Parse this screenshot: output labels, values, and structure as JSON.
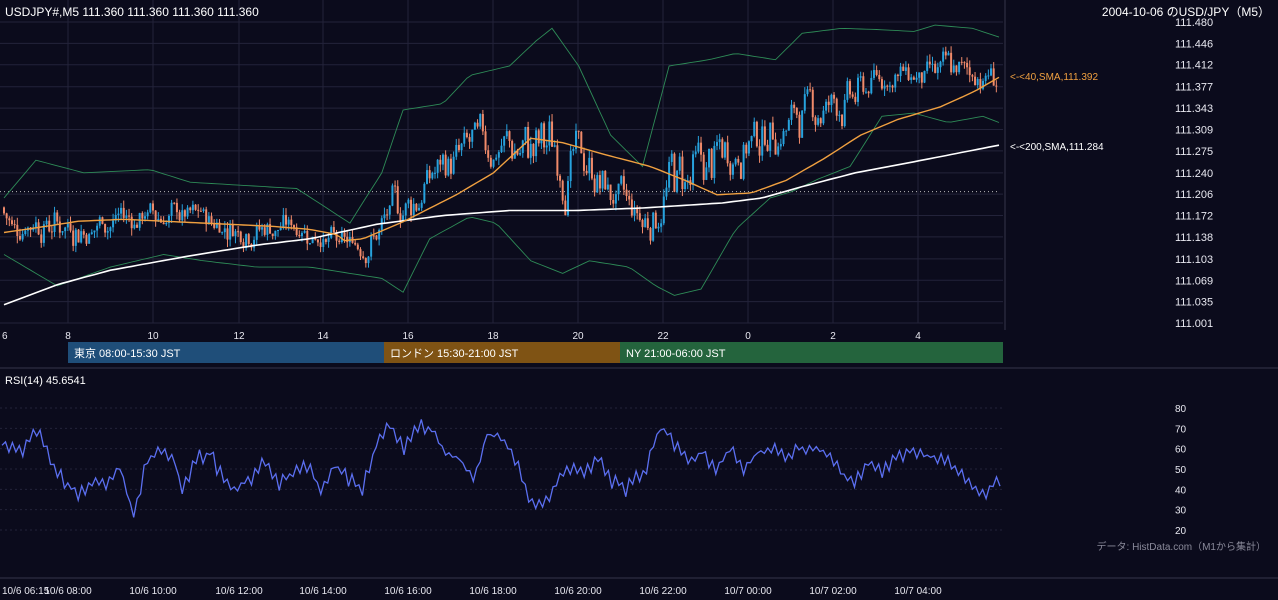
{
  "header": {
    "symbol_info": "USDJPY#,M5 111.360 111.360 111.360 111.360",
    "title": "2004-10-06 のUSD/JPY（M5）"
  },
  "rsi": {
    "label": "RSI(14) 45.6541"
  },
  "credit": "データ: HistData.com（M1から集計）",
  "sessions": [
    {
      "label": "東京 08:00-15:30 JST",
      "color": "#1f4e79"
    },
    {
      "label": "ロンドン 15:30-21:00 JST",
      "color": "#7f5314"
    },
    {
      "label": "NY 21:00-06:00 JST",
      "color": "#24643d"
    }
  ],
  "colors": {
    "background": "#0b0b1c",
    "up_candle": "#27a2dd",
    "down_candle": "#f08a6a",
    "sma40": "#f0a040",
    "sma200": "#ffffff",
    "bollinger": "#2e8b57",
    "rsi_line": "#5b6ff0",
    "grid": "#23233a"
  },
  "chart_data": [
    {
      "type": "candlestick",
      "title": "2004-10-06 のUSD/JPY（M5）",
      "y_ticks": [
        "111.480",
        "111.446",
        "111.412",
        "111.377",
        "111.343",
        "111.309",
        "111.275",
        "111.240",
        "111.206",
        "111.172",
        "111.138",
        "111.103",
        "111.069",
        "111.035",
        "111.001"
      ],
      "ylim": [
        111.001,
        111.48
      ],
      "x_ticks": [
        "6",
        "8",
        "10",
        "12",
        "14",
        "16",
        "18",
        "20",
        "22",
        "0",
        "2",
        "4"
      ],
      "dotted_level": 111.21,
      "indicators": [
        {
          "name": "40,SMA",
          "label": "<-<40,SMA,111.392",
          "last": 111.392
        },
        {
          "name": "200,SMA",
          "label": "<-<200,SMA,111.284",
          "last": 111.284
        },
        {
          "name": "Bollinger Bands"
        }
      ],
      "sma40_path": [
        [
          0,
          111.145
        ],
        [
          16,
          111.155
        ],
        [
          28,
          111.163
        ],
        [
          45,
          111.166
        ],
        [
          60,
          111.163
        ],
        [
          85,
          111.158
        ],
        [
          100,
          111.155
        ],
        [
          115,
          111.15
        ],
        [
          125,
          111.142
        ],
        [
          128,
          111.132
        ],
        [
          135,
          111.135
        ],
        [
          150,
          111.162
        ],
        [
          170,
          111.205
        ],
        [
          184,
          111.24
        ],
        [
          198,
          111.295
        ],
        [
          210,
          111.288
        ],
        [
          225,
          111.27
        ],
        [
          243,
          111.25
        ],
        [
          256,
          111.228
        ],
        [
          268,
          111.205
        ],
        [
          281,
          111.208
        ],
        [
          294,
          111.228
        ],
        [
          308,
          111.262
        ],
        [
          322,
          111.3
        ],
        [
          336,
          111.325
        ],
        [
          352,
          111.345
        ],
        [
          365,
          111.37
        ],
        [
          374,
          111.392
        ]
      ],
      "sma200_path": [
        [
          0,
          111.03
        ],
        [
          20,
          111.062
        ],
        [
          40,
          111.085
        ],
        [
          70,
          111.108
        ],
        [
          95,
          111.125
        ],
        [
          115,
          111.135
        ],
        [
          140,
          111.158
        ],
        [
          165,
          111.172
        ],
        [
          190,
          111.18
        ],
        [
          215,
          111.18
        ],
        [
          240,
          111.184
        ],
        [
          270,
          111.192
        ],
        [
          285,
          111.2
        ],
        [
          300,
          111.218
        ],
        [
          320,
          111.24
        ],
        [
          345,
          111.26
        ],
        [
          374,
          111.284
        ]
      ],
      "bollinger_upper_path": [
        [
          0,
          111.2
        ],
        [
          12,
          111.26
        ],
        [
          30,
          111.24
        ],
        [
          55,
          111.245
        ],
        [
          70,
          111.225
        ],
        [
          90,
          111.22
        ],
        [
          110,
          111.215
        ],
        [
          130,
          111.16
        ],
        [
          142,
          111.24
        ],
        [
          150,
          111.34
        ],
        [
          165,
          111.35
        ],
        [
          175,
          111.395
        ],
        [
          190,
          111.41
        ],
        [
          200,
          111.45
        ],
        [
          206,
          111.47
        ],
        [
          216,
          111.41
        ],
        [
          228,
          111.3
        ],
        [
          240,
          111.25
        ],
        [
          250,
          111.41
        ],
        [
          265,
          111.42
        ],
        [
          275,
          111.43
        ],
        [
          290,
          111.42
        ],
        [
          300,
          111.462
        ],
        [
          315,
          111.47
        ],
        [
          328,
          111.468
        ],
        [
          342,
          111.465
        ],
        [
          350,
          111.475
        ],
        [
          364,
          111.47
        ],
        [
          374,
          111.456
        ]
      ],
      "bollinger_lower_path": [
        [
          0,
          111.11
        ],
        [
          20,
          111.06
        ],
        [
          40,
          111.09
        ],
        [
          60,
          111.11
        ],
        [
          75,
          111.1
        ],
        [
          95,
          111.09
        ],
        [
          115,
          111.09
        ],
        [
          130,
          111.08
        ],
        [
          142,
          111.072
        ],
        [
          150,
          111.05
        ],
        [
          160,
          111.135
        ],
        [
          175,
          111.17
        ],
        [
          185,
          111.16
        ],
        [
          198,
          111.1
        ],
        [
          210,
          111.08
        ],
        [
          220,
          111.1
        ],
        [
          235,
          111.09
        ],
        [
          245,
          111.06
        ],
        [
          252,
          111.045
        ],
        [
          262,
          111.055
        ],
        [
          275,
          111.15
        ],
        [
          288,
          111.2
        ],
        [
          296,
          111.21
        ],
        [
          306,
          111.23
        ],
        [
          318,
          111.25
        ],
        [
          330,
          111.33
        ],
        [
          342,
          111.335
        ],
        [
          355,
          111.32
        ],
        [
          368,
          111.33
        ],
        [
          374,
          111.32
        ]
      ]
    },
    {
      "type": "line",
      "title": "RSI(14) 45.6541",
      "y_ticks": [
        "80",
        "70",
        "60",
        "50",
        "40",
        "30",
        "20"
      ],
      "ylim": [
        20,
        80
      ],
      "x_ticks": [
        "10/6 06:15",
        "10/6 08:00",
        "10/6 10:00",
        "10/6 12:00",
        "10/6 14:00",
        "10/6 16:00",
        "10/6 18:00",
        "10/6 20:00",
        "10/6 22:00",
        "10/7 00:00",
        "10/7 02:00",
        "10/7 04:00"
      ],
      "x_tick_positions": [
        0,
        21,
        45,
        69,
        93,
        117,
        141,
        165,
        189,
        213,
        237,
        261
      ],
      "last": 45.6541,
      "anchors": [
        [
          0,
          63
        ],
        [
          6,
          60
        ],
        [
          10,
          70
        ],
        [
          14,
          55
        ],
        [
          18,
          44
        ],
        [
          22,
          38
        ],
        [
          26,
          43
        ],
        [
          30,
          42
        ],
        [
          34,
          50
        ],
        [
          38,
          28
        ],
        [
          42,
          55
        ],
        [
          46,
          58
        ],
        [
          50,
          55
        ],
        [
          52,
          38
        ],
        [
          56,
          55
        ],
        [
          60,
          58
        ],
        [
          64,
          44
        ],
        [
          68,
          40
        ],
        [
          72,
          46
        ],
        [
          76,
          55
        ],
        [
          80,
          42
        ],
        [
          84,
          48
        ],
        [
          88,
          52
        ],
        [
          92,
          40
        ],
        [
          96,
          52
        ],
        [
          100,
          45
        ],
        [
          104,
          40
        ],
        [
          108,
          62
        ],
        [
          112,
          72
        ],
        [
          116,
          60
        ],
        [
          120,
          72
        ],
        [
          124,
          70
        ],
        [
          128,
          58
        ],
        [
          132,
          55
        ],
        [
          136,
          45
        ],
        [
          140,
          67
        ],
        [
          144,
          65
        ],
        [
          148,
          55
        ],
        [
          152,
          36
        ],
        [
          156,
          32
        ],
        [
          160,
          44
        ],
        [
          164,
          50
        ],
        [
          168,
          48
        ],
        [
          172,
          55
        ],
        [
          176,
          44
        ],
        [
          180,
          40
        ],
        [
          186,
          50
        ],
        [
          190,
          72
        ],
        [
          194,
          62
        ],
        [
          198,
          55
        ],
        [
          202,
          58
        ],
        [
          206,
          48
        ],
        [
          210,
          60
        ],
        [
          214,
          50
        ],
        [
          218,
          58
        ],
        [
          222,
          60
        ],
        [
          226,
          55
        ],
        [
          230,
          60
        ],
        [
          234,
          62
        ],
        [
          238,
          58
        ],
        [
          242,
          48
        ],
        [
          246,
          44
        ],
        [
          250,
          52
        ],
        [
          254,
          48
        ],
        [
          258,
          55
        ],
        [
          262,
          60
        ],
        [
          266,
          57
        ],
        [
          270,
          55
        ],
        [
          272,
          55
        ],
        [
          276,
          50
        ],
        [
          280,
          42
        ],
        [
          284,
          38
        ],
        [
          288,
          45
        ]
      ]
    }
  ]
}
